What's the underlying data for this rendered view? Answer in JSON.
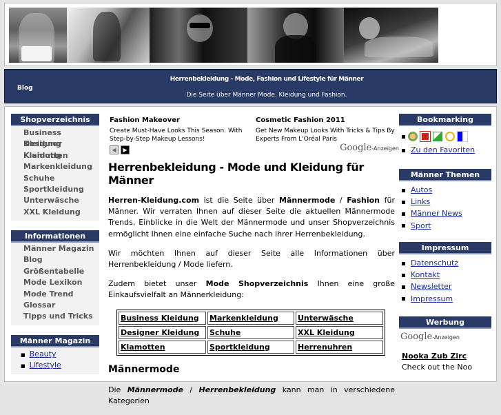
{
  "header": {
    "nav_blog": "Blog",
    "site_title": "Herrenbekleidung - Mode, Fashion und Lifestyle für Männer",
    "tagline": "Die Seite über Männer Mode. Kleidung und Fashion."
  },
  "left": {
    "shop": {
      "title": "Shopverzeichnis",
      "items": [
        "Business Kleidung",
        "Designer Kleidung",
        "Klamotten",
        "Markenkleidung",
        "Schuhe",
        "Sportkleidung",
        "Unterwäsche",
        "XXL Kleidung"
      ]
    },
    "info": {
      "title": "Informationen",
      "items": [
        "Männer Magazin",
        "Blog",
        "Größentabelle",
        "Mode Lexikon",
        "Mode Trend",
        "Glossar",
        "Tipps und Tricks"
      ]
    },
    "magazin": {
      "title": "Männer Magazin",
      "items": [
        "Beauty",
        "Lifestyle"
      ]
    }
  },
  "ads": {
    "ad1": {
      "title": "Fashion Makeover",
      "text": "Create Must-Have Looks This Season. With Step-by-Step Makeup Lessons!"
    },
    "ad2": {
      "title": "Cosmetic Fashion 2011",
      "text": "Get New Makeup Looks With Tricks & Tips By Experts From L'Oréal Paris"
    },
    "google": "Google",
    "anzeigen": "-Anzeigen"
  },
  "main": {
    "heading": "Herrenbekleidung - Mode und Kleidung für Männer",
    "p1_site": "Herren-Kleidung.com",
    "p1_a": " ist die Seite über ",
    "p1_b": "Männermode",
    "p1_c": " / ",
    "p1_d": "Fashion",
    "p1_e": " für Männer. Wir verraten Ihnen auf dieser Seite die aktuellen Männermode Trends, Einblicke in die Welt der Männermode und unser Shopverzeichnis ermöglicht Ihnen eine einfache Suche nach ihrer Herrenbekleidung.",
    "p2": "Wir möchten Ihnen auf dieser Seite alle Informationen über Herrenbekleidung / Mode liefern.",
    "p3_a": "Zudem bietet unser ",
    "p3_b": "Mode Shopverzeichnis",
    "p3_c": " Ihnen eine große Einkaufsvielfalt an Männerkleidung:",
    "table": [
      [
        "Business Kleidung",
        "Markenkleidung",
        "Unterwäsche"
      ],
      [
        "Designer Kleidung",
        "Schuhe",
        "XXL Kleidung"
      ],
      [
        "Klamotten",
        "Sportkleidung",
        "Herrenuhren"
      ]
    ],
    "h2": "Männermode",
    "p4_a": "Die ",
    "p4_b": "Männermode",
    "p4_c": " / ",
    "p4_d": "Herrenbekleidung",
    "p4_e": " kann man in verschiedene Kategorien"
  },
  "right": {
    "bookmark": {
      "title": "Bookmarking",
      "fav": "Zu den Favoriten"
    },
    "themen": {
      "title": "Männer Themen",
      "items": [
        "Autos",
        "Links",
        "Männer News",
        "Sport"
      ]
    },
    "impressum": {
      "title": "Impressum",
      "items": [
        "Datenschutz",
        "Kontakt",
        "Newsletter",
        "Impressum"
      ]
    },
    "werbung": {
      "title": "Werbung",
      "google": "Google",
      "anzeigen": "-Anzeigen",
      "ad_title": "Nooka Zub Zirc",
      "ad_text": "Check out the Noo"
    }
  },
  "colors": {
    "navy": "#2a3a66",
    "link": "#1a2a9a",
    "side_bg": "#f2f2f2"
  }
}
